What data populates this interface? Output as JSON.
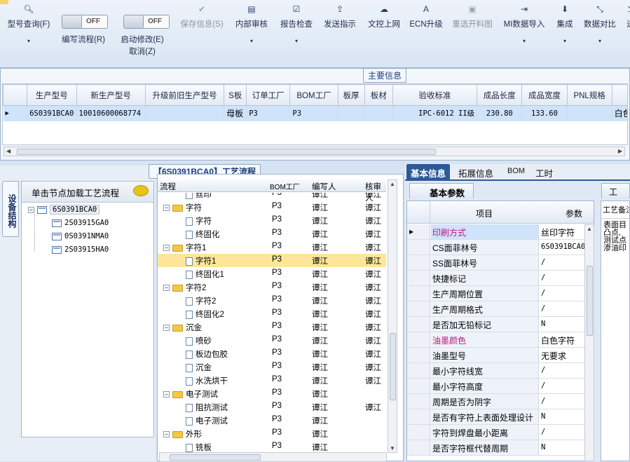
{
  "toolbar": {
    "buttons": [
      {
        "icon": "search-icon",
        "label": "型号查询(F)",
        "dropdown": true
      },
      {
        "icon": "save-icon",
        "label": "保存信息(S)",
        "disabled": true
      },
      {
        "icon": "print-icon",
        "label": "内部审核",
        "dropdown": true
      },
      {
        "icon": "check-icon",
        "label": "报告检查",
        "dropdown": true
      },
      {
        "icon": "upload-icon",
        "label": "发送指示"
      },
      {
        "icon": "cloud-upload-icon",
        "label": "文控上网"
      },
      {
        "icon": "ecn-icon",
        "label": "ECN升级"
      },
      {
        "icon": "image-icon",
        "label": "重选开料图",
        "disabled": true
      },
      {
        "icon": "import-icon",
        "label": "MI数据导入",
        "dropdown": true
      },
      {
        "icon": "download-icon",
        "label": "集成",
        "dropdown": true
      },
      {
        "icon": "compare-icon",
        "label": "数据对比",
        "dropdown": true
      },
      {
        "icon": "more-icon",
        "label": "进"
      }
    ],
    "toggles": [
      {
        "state": "OFF",
        "label": "编写流程(R)"
      },
      {
        "state": "OFF",
        "label": "启动修改(E)",
        "label2": "取消(Z)"
      }
    ]
  },
  "main_info": {
    "title": "主要信息",
    "columns": [
      "生产型号",
      "新生产型号",
      "升级前旧生产型号",
      "S板",
      "订单工厂",
      "BOM工厂",
      "板厚",
      "板材",
      "验收标准",
      "成品长度",
      "成品宽度",
      "PNL规格",
      "生"
    ],
    "rows": [
      [
        "6S0391BCA0",
        "10010600068774",
        "",
        "母板",
        "P3",
        "P3",
        "",
        "",
        "IPC-6012 II级",
        "230.80",
        "133.60",
        "",
        "白色"
      ]
    ]
  },
  "left_panel": {
    "side_tab": "设备结构",
    "header": "单击节点加载工艺流程",
    "tree": [
      {
        "label": "6S0391BCA0",
        "level": 0
      },
      {
        "label": "2S03915GA0",
        "level": 1
      },
      {
        "label": "0S0391NMA0",
        "level": 1
      },
      {
        "label": "2S03915HA0",
        "level": 1
      }
    ]
  },
  "flow_panel": {
    "title": "【6S0391BCA0】工艺流程",
    "columns": [
      "流程",
      "BOM工厂",
      "编写人",
      "核审人"
    ],
    "rows": [
      {
        "name": "丝印",
        "type": "doc",
        "level": 1,
        "factory": "P3",
        "writer": "谭江",
        "reviewer": "谭江"
      },
      {
        "name": "字符",
        "type": "folder",
        "level": 0,
        "factory": "P3",
        "writer": "谭江",
        "reviewer": "谭江"
      },
      {
        "name": "字符",
        "type": "doc",
        "level": 1,
        "factory": "P3",
        "writer": "谭江",
        "reviewer": "谭江"
      },
      {
        "name": "终固化",
        "type": "doc",
        "level": 1,
        "factory": "P3",
        "writer": "谭江",
        "reviewer": "谭江"
      },
      {
        "name": "字符1",
        "type": "folder",
        "level": 0,
        "factory": "P3",
        "writer": "谭江",
        "reviewer": "谭江"
      },
      {
        "name": "字符1",
        "type": "doc",
        "level": 1,
        "factory": "P3",
        "writer": "谭江",
        "reviewer": "谭江",
        "selected": true
      },
      {
        "name": "终固化1",
        "type": "doc",
        "level": 1,
        "factory": "P3",
        "writer": "谭江",
        "reviewer": "谭江"
      },
      {
        "name": "字符2",
        "type": "folder",
        "level": 0,
        "factory": "P3",
        "writer": "谭江",
        "reviewer": "谭江"
      },
      {
        "name": "字符2",
        "type": "doc",
        "level": 1,
        "factory": "P3",
        "writer": "谭江",
        "reviewer": "谭江"
      },
      {
        "name": "终固化2",
        "type": "doc",
        "level": 1,
        "factory": "P3",
        "writer": "谭江",
        "reviewer": "谭江"
      },
      {
        "name": "沉金",
        "type": "folder",
        "level": 0,
        "factory": "P3",
        "writer": "谭江",
        "reviewer": "谭江"
      },
      {
        "name": "喷砂",
        "type": "doc",
        "level": 1,
        "factory": "P3",
        "writer": "谭江",
        "reviewer": "谭江"
      },
      {
        "name": "板边包胶",
        "type": "doc",
        "level": 1,
        "factory": "P3",
        "writer": "谭江",
        "reviewer": "谭江"
      },
      {
        "name": "沉金",
        "type": "doc",
        "level": 1,
        "factory": "P3",
        "writer": "谭江",
        "reviewer": "谭江"
      },
      {
        "name": "水洗烘干",
        "type": "doc",
        "level": 1,
        "factory": "P3",
        "writer": "谭江",
        "reviewer": "谭江"
      },
      {
        "name": "电子测试",
        "type": "folder",
        "level": 0,
        "factory": "P3",
        "writer": "谭江",
        "reviewer": ""
      },
      {
        "name": "阻抗测试",
        "type": "doc",
        "level": 1,
        "factory": "P3",
        "writer": "谭江",
        "reviewer": "谭江"
      },
      {
        "name": "电子测试",
        "type": "doc",
        "level": 1,
        "factory": "P3",
        "writer": "谭江",
        "reviewer": ""
      },
      {
        "name": "外形",
        "type": "folder",
        "level": 0,
        "factory": "P3",
        "writer": "谭江",
        "reviewer": ""
      },
      {
        "name": "铣板",
        "type": "doc",
        "level": 1,
        "factory": "P3",
        "writer": "谭江",
        "reviewer": ""
      }
    ]
  },
  "right_panel": {
    "tabs": [
      "基本信息",
      "拓展信息",
      "BOM",
      "工时"
    ],
    "active_tab": "基本信息",
    "subtab": "基本参数",
    "columns": [
      "项目",
      "参数"
    ],
    "params": [
      {
        "key": "印刷方式",
        "value": "丝印字符",
        "highlight": true,
        "selected": true
      },
      {
        "key": "CS面菲林号",
        "value": "6S0391BCA0."
      },
      {
        "key": "SS面菲林号",
        "value": "/"
      },
      {
        "key": "快捷标记",
        "value": "/"
      },
      {
        "key": "生产周期位置",
        "value": "/"
      },
      {
        "key": "生产周期格式",
        "value": "/"
      },
      {
        "key": "是否加无铅标记",
        "value": "N"
      },
      {
        "key": "油墨颜色",
        "value": "白色字符",
        "highlight": true
      },
      {
        "key": "油墨型号",
        "value": "无要求"
      },
      {
        "key": "最小字符线宽",
        "value": "/"
      },
      {
        "key": "最小字符高度",
        "value": "/"
      },
      {
        "key": "周期是否为阴字",
        "value": "/"
      },
      {
        "key": "是否有字符上表面处理设计",
        "value": "N"
      },
      {
        "key": "字符到焊盘最小距离",
        "value": "/"
      },
      {
        "key": "是否字符框代替周期",
        "value": "N"
      }
    ],
    "notes_tab": "工",
    "notes_title": "工艺备注",
    "notes_lines": [
      "表面目",
      "凸点,",
      "测试点",
      "渗油印"
    ]
  },
  "colors": {
    "accent": "#2c5a96",
    "selection": "#cfe3fb",
    "flow_selection": "#fde69a",
    "highlight_text": "#c0157c"
  }
}
